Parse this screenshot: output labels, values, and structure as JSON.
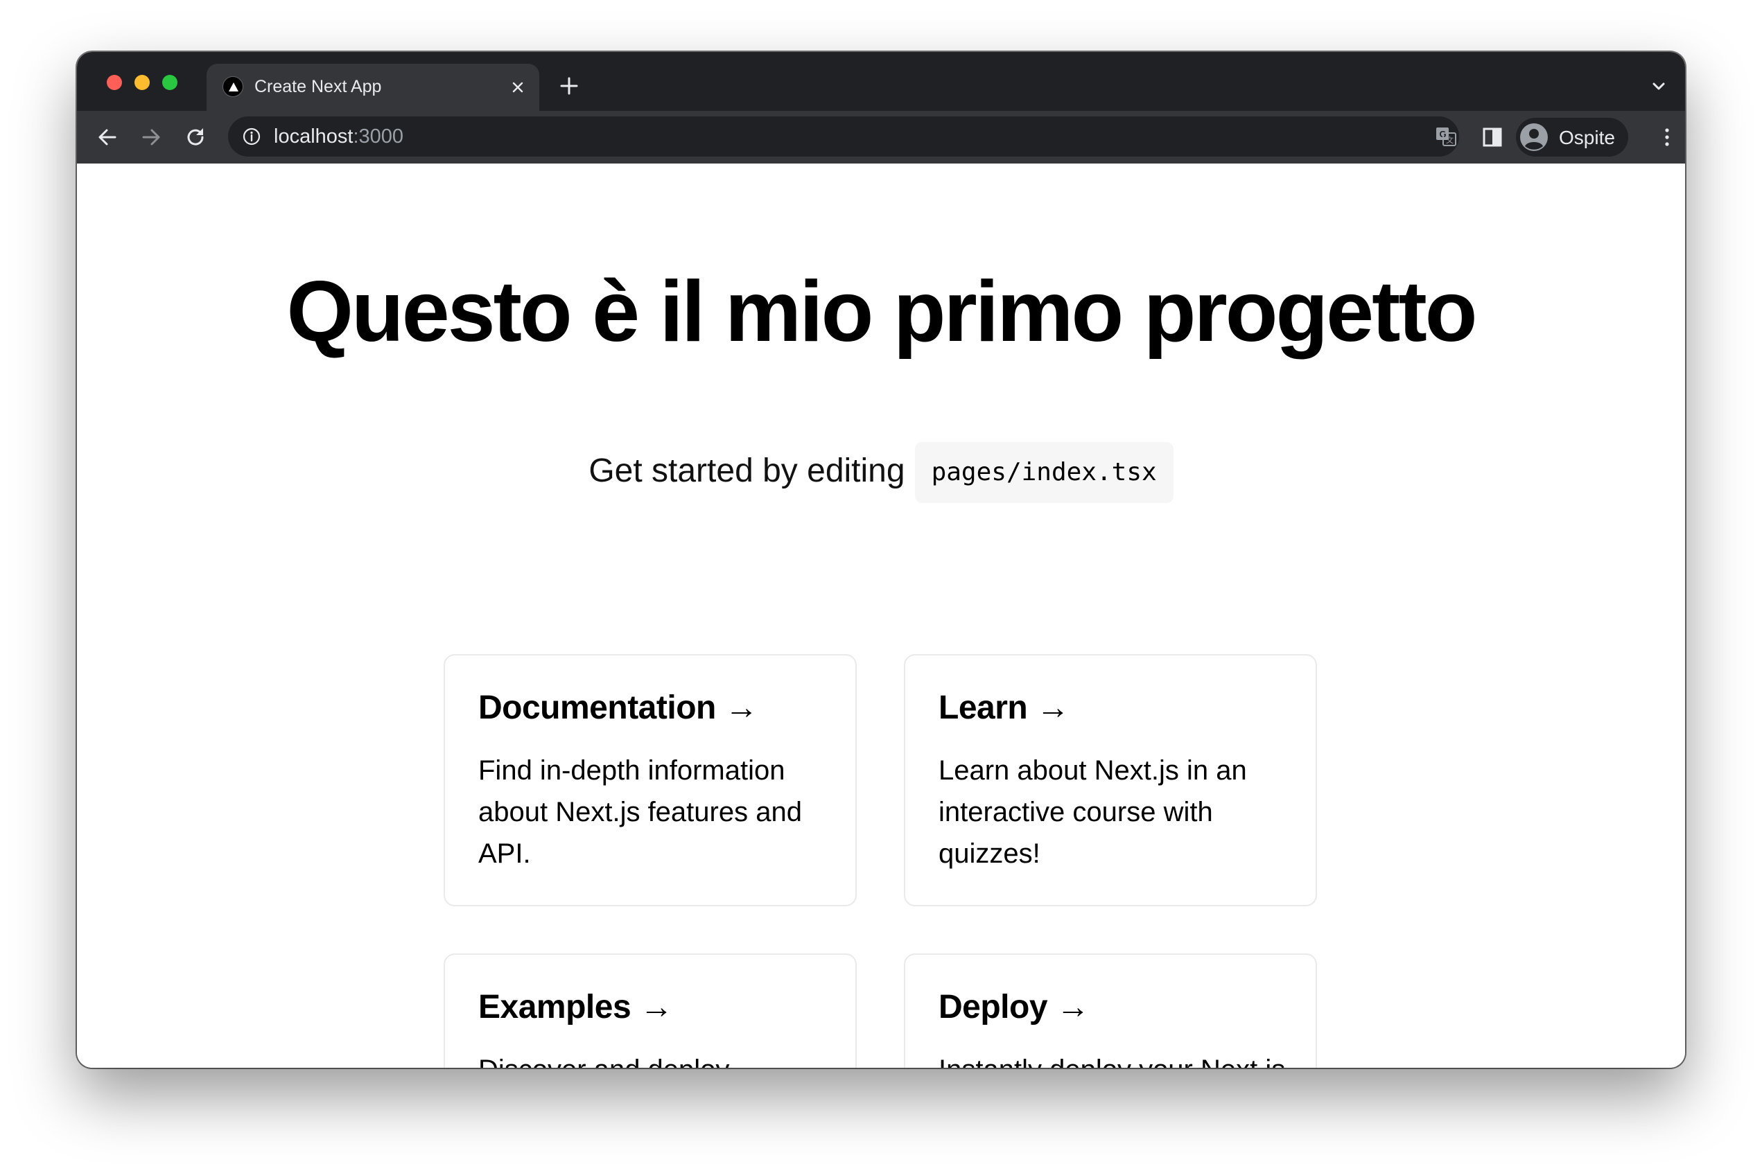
{
  "browser": {
    "tab": {
      "title": "Create Next App",
      "favicon": "nextjs-triangle-icon"
    },
    "toolbar": {
      "back_icon": "back-arrow-icon",
      "forward_icon": "forward-arrow-icon",
      "reload_icon": "reload-icon",
      "info_icon": "info-icon",
      "translate_icon": "translate-icon",
      "sidepanel_icon": "side-panel-icon",
      "menu_icon": "kebab-menu-icon"
    },
    "omnibox": {
      "host": "localhost",
      "port": ":3000"
    },
    "profile": {
      "name": "Ospite",
      "avatar_icon": "guest-avatar-icon"
    },
    "colors": {
      "tabstrip": "#202124",
      "toolbar": "#35363a",
      "text": "#e8eaed",
      "muted": "#9aa0a6"
    }
  },
  "page": {
    "title": "Questo è il mio primo progetto",
    "subtitle": {
      "text": "Get started by editing",
      "code": "pages/index.tsx"
    },
    "cards": [
      {
        "title": "Documentation →",
        "text": "Find in-depth information about Next.js features and API."
      },
      {
        "title": "Learn →",
        "text": "Learn about Next.js in an interactive course with quizzes!"
      },
      {
        "title": "Examples →",
        "text": "Discover and deploy boilerplate example Next.js projects."
      },
      {
        "title": "Deploy →",
        "text": "Instantly deploy your Next.js site to a public URL with Vercel."
      }
    ]
  }
}
